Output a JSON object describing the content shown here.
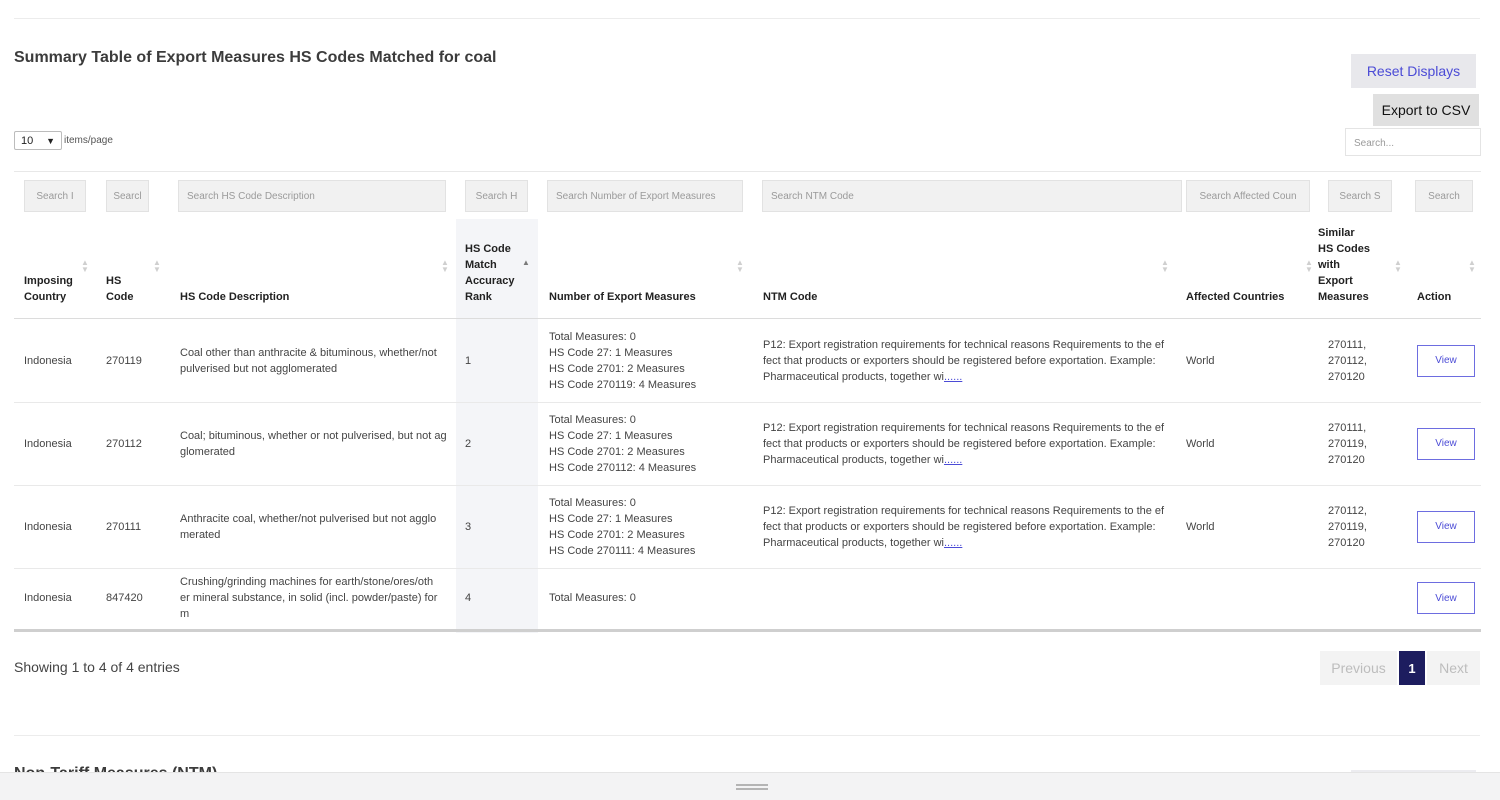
{
  "title": "Summary Table of Export Measures HS Codes Matched for coal",
  "buttons": {
    "reset": "Reset Displays",
    "export": "Export to CSV",
    "view": "View"
  },
  "length_menu": {
    "value": "10",
    "label": "items/page"
  },
  "global_search": {
    "placeholder": "Search..."
  },
  "column_filters": [
    "Search I",
    "Searcl",
    "Search HS Code Description",
    "Search H",
    "Search Number of Export Measures",
    "Search NTM Code",
    "Search Affected Coun",
    "Search S",
    "Search"
  ],
  "columns": [
    {
      "lines": [
        "Imposing",
        "Country"
      ]
    },
    {
      "lines": [
        "HS",
        "Code"
      ]
    },
    {
      "lines": [
        "HS Code Description"
      ]
    },
    {
      "lines": [
        "HS Code",
        "Match",
        "Accuracy",
        "Rank"
      ],
      "sorted": "asc"
    },
    {
      "lines": [
        "Number of Export Measures"
      ]
    },
    {
      "lines": [
        "NTM Code"
      ]
    },
    {
      "lines": [
        "Affected Countries"
      ]
    },
    {
      "lines": [
        "Similar",
        "HS Codes",
        "with",
        "Export",
        "Measures"
      ]
    },
    {
      "lines": [
        "Action"
      ]
    }
  ],
  "rows": [
    {
      "country": "Indonesia",
      "hs_code": "270119",
      "description": [
        "Coal other than anthracite & bituminous, whether/not",
        "pulverised but not agglomerated"
      ],
      "rank": "1",
      "measures": [
        "Total Measures: 0",
        "HS Code 27: 1 Measures",
        "HS Code 2701: 2 Measures",
        "HS Code 270119: 4 Measures"
      ],
      "ntm": [
        "P12: Export registration requirements for technical reasons Requirements to the ef",
        "fect that products or exporters should be registered before exportation. Example:",
        "Pharmaceutical products, together wi"
      ],
      "ntm_more": "......",
      "affected": "World",
      "similar": [
        "270111,",
        "270112,",
        "270120"
      ]
    },
    {
      "country": "Indonesia",
      "hs_code": "270112",
      "description": [
        "Coal; bituminous, whether or not pulverised, but not ag",
        "glomerated"
      ],
      "rank": "2",
      "measures": [
        "Total Measures: 0",
        "HS Code 27: 1 Measures",
        "HS Code 2701: 2 Measures",
        "HS Code 270112: 4 Measures"
      ],
      "ntm": [
        "P12: Export registration requirements for technical reasons Requirements to the ef",
        "fect that products or exporters should be registered before exportation. Example:",
        "Pharmaceutical products, together wi"
      ],
      "ntm_more": "......",
      "affected": "World",
      "similar": [
        "270111,",
        "270119,",
        "270120"
      ]
    },
    {
      "country": "Indonesia",
      "hs_code": "270111",
      "description": [
        "Anthracite coal, whether/not pulverised but not agglo",
        "merated"
      ],
      "rank": "3",
      "measures": [
        "Total Measures: 0",
        "HS Code 27: 1 Measures",
        "HS Code 2701: 2 Measures",
        "HS Code 270111: 4 Measures"
      ],
      "ntm": [
        "P12: Export registration requirements for technical reasons Requirements to the ef",
        "fect that products or exporters should be registered before exportation. Example:",
        "Pharmaceutical products, together wi"
      ],
      "ntm_more": "......",
      "affected": "World",
      "similar": [
        "270112,",
        "270119,",
        "270120"
      ]
    },
    {
      "country": "Indonesia",
      "hs_code": "847420",
      "description": [
        "Crushing/grinding machines for earth/stone/ores/oth",
        "er mineral substance, in solid (incl. powder/paste) for",
        "m"
      ],
      "rank": "4",
      "measures": [
        "Total Measures: 0"
      ],
      "ntm": [],
      "ntm_more": "",
      "affected": "",
      "similar": []
    }
  ],
  "info": "Showing 1 to 4 of 4 entries",
  "pagination": {
    "previous": "Previous",
    "current": "1",
    "next": "Next"
  },
  "next_section_title": "Non-Tariff Measures (NTM)",
  "icons": {
    "sort": "sort-icon",
    "chevron": "chevron-down-icon",
    "drag": "drag-handle-icon"
  }
}
